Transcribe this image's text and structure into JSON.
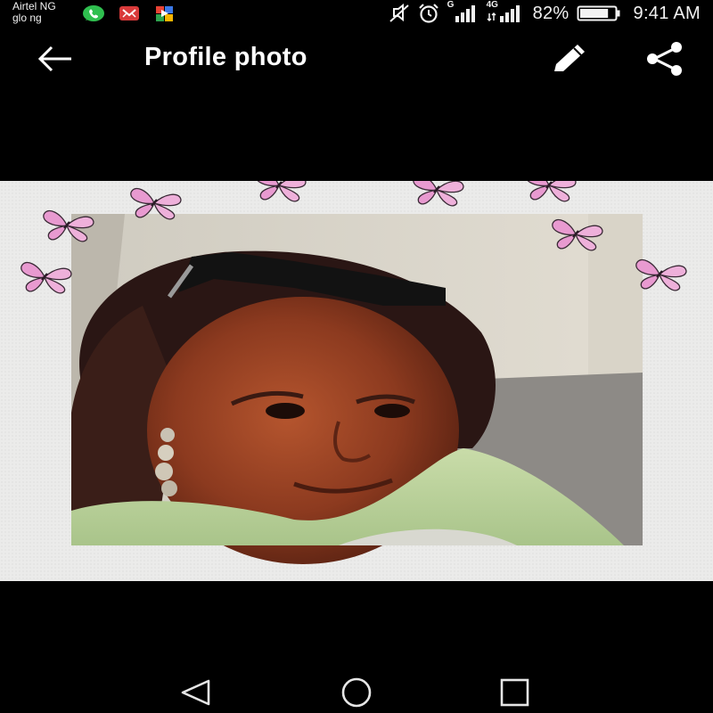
{
  "status_bar": {
    "carrier_1": "Airtel NG",
    "carrier_2": "glo ng",
    "notification_icons": [
      "whatsapp-icon",
      "mail-icon",
      "play-store-icon"
    ],
    "signal_1_label": "G",
    "signal_2_label": "4G",
    "battery_percent": "82%",
    "battery_level": 0.82,
    "time": "9:41 AM"
  },
  "app_bar": {
    "title": "Profile photo",
    "icons": [
      "back-arrow-icon",
      "edit-pencil-icon",
      "share-icon"
    ]
  },
  "photo": {
    "subject": "profile photo with butterfly frame",
    "butterfly_color": "#e89ad0"
  },
  "nav_bar": {
    "icons": [
      "nav-back-icon",
      "nav-home-icon",
      "nav-recents-icon"
    ]
  }
}
